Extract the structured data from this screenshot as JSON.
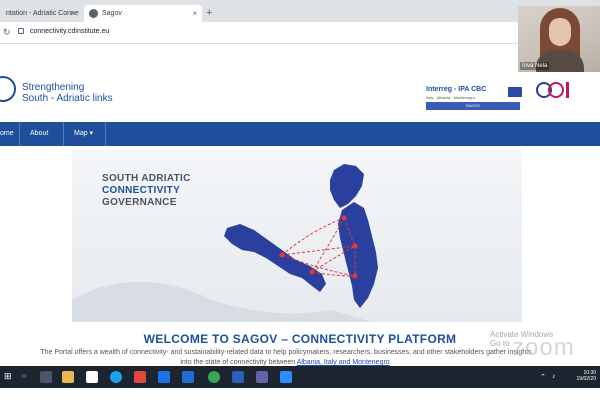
{
  "browser": {
    "tabs": [
      {
        "label": "ntation - Adriatic Conne",
        "active": false
      },
      {
        "label": "Sagov",
        "active": true
      }
    ],
    "new_tab": "+",
    "close_symbol": "×",
    "url": "connectivity.cdinstitute.eu"
  },
  "webcam": {
    "participant_name": "Inva Nela"
  },
  "site": {
    "brand_line1": "Strengthening",
    "brand_line2": "South - Adriatic links",
    "interreg": {
      "title": "Interreg - IPA CBC",
      "countries": "Italy - Albania - Montenegro",
      "project": "SAGOV"
    },
    "nav": [
      {
        "label": "ome"
      },
      {
        "label": "About"
      },
      {
        "label": "Map ▾"
      }
    ],
    "hero": {
      "line1": "SOUTH ADRIATIC",
      "line2": "CONNECTIVITY",
      "line3": "GOVERNANCE"
    },
    "welcome_title": "WELCOME TO SAGOV – CONNECTIVITY PLATFORM",
    "intro_text_start": "The Portal offers a wealth of connectivity- and sustainability-related data to help policymakers, researchers, businesses, and other stakeholders gather insights into the state of connectivity between ",
    "intro_highlight": "Albania, Italy and Montenegro",
    "intro_end": "."
  },
  "overlays": {
    "activate_line1": "Activate Windows",
    "activate_line2": "Go to",
    "zoom_watermark": "zoom"
  },
  "taskbar": {
    "time": "10:30",
    "date": "19/02/20"
  },
  "colors": {
    "brand_blue": "#1e4fa0",
    "nav_blue": "#1f4e9c",
    "route_red": "#e53935",
    "map_blue": "#2b3f9e",
    "taskbar": "#1c2430"
  }
}
